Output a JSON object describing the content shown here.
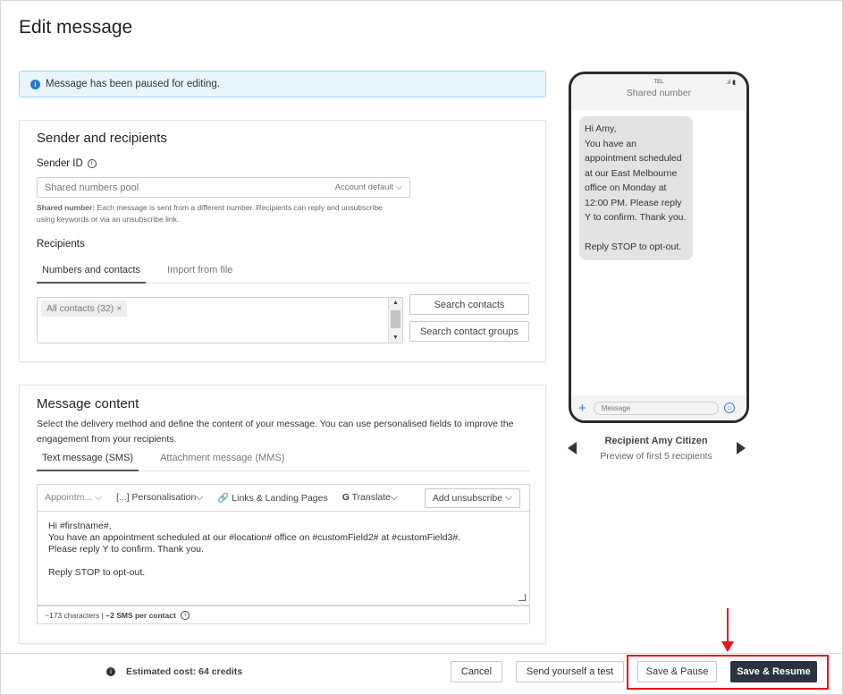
{
  "page": {
    "title": "Edit message"
  },
  "notice": {
    "text": "Message has been paused for editing."
  },
  "sender": {
    "section_title": "Sender and recipients",
    "sender_id_label": "Sender ID",
    "select_value": "Shared numbers pool",
    "select_right": "Account default",
    "help_bold": "Shared number:",
    "help_text": " Each message is sent from a different number. Recipients can reply and unsubscribe using keywords or via an unsubscribe link."
  },
  "recipients": {
    "label": "Recipients",
    "tabs": [
      "Numbers and contacts",
      "Import from file"
    ],
    "chip": "All contacts (32)",
    "search_contacts": "Search contacts",
    "search_groups": "Search contact groups"
  },
  "content": {
    "section_title": "Message content",
    "description": "Select the delivery method and define the content of your message. You can use personalised fields to improve the engagement from your recipients.",
    "tabs": [
      "Text message (SMS)",
      "Attachment message (MMS)"
    ],
    "toolbar": {
      "template": "Appointm...",
      "personalisation": "Personalisation",
      "links": "Links & Landing Pages",
      "translate": "Translate",
      "unsubscribe": "Add unsubscribe"
    },
    "body": "Hi #firstname#,\nYou have an appointment scheduled at our #location# office on #customField2# at #customField3#.\nPlease reply Y to confirm. Thank you.\n\nReply STOP to opt-out.",
    "counter_prefix": "~173 characters | ",
    "counter_bold": "~2 SMS per contact"
  },
  "preview": {
    "carrier": "TEL",
    "sender": "Shared number",
    "bubble": "Hi Amy,\nYou have an appointment scheduled at our East Melbourne office on Monday at 12:00 PM. Please reply Y to confirm. Thank you.\n\nReply STOP to opt-out.",
    "input_placeholder": "Message",
    "recipient_name": "Recipient Amy Citizen",
    "recipient_sub": "Preview of first 5 recipients"
  },
  "footer": {
    "cost": "Estimated cost: 64 credits",
    "cancel": "Cancel",
    "test": "Send yourself a test",
    "pause": "Save & Pause",
    "resume": "Save & Resume"
  },
  "colors": {
    "accent": "#2a78c6",
    "dark_button": "#2c3340",
    "highlight": "#e8141c",
    "notice_bg": "#e8f6fb"
  }
}
